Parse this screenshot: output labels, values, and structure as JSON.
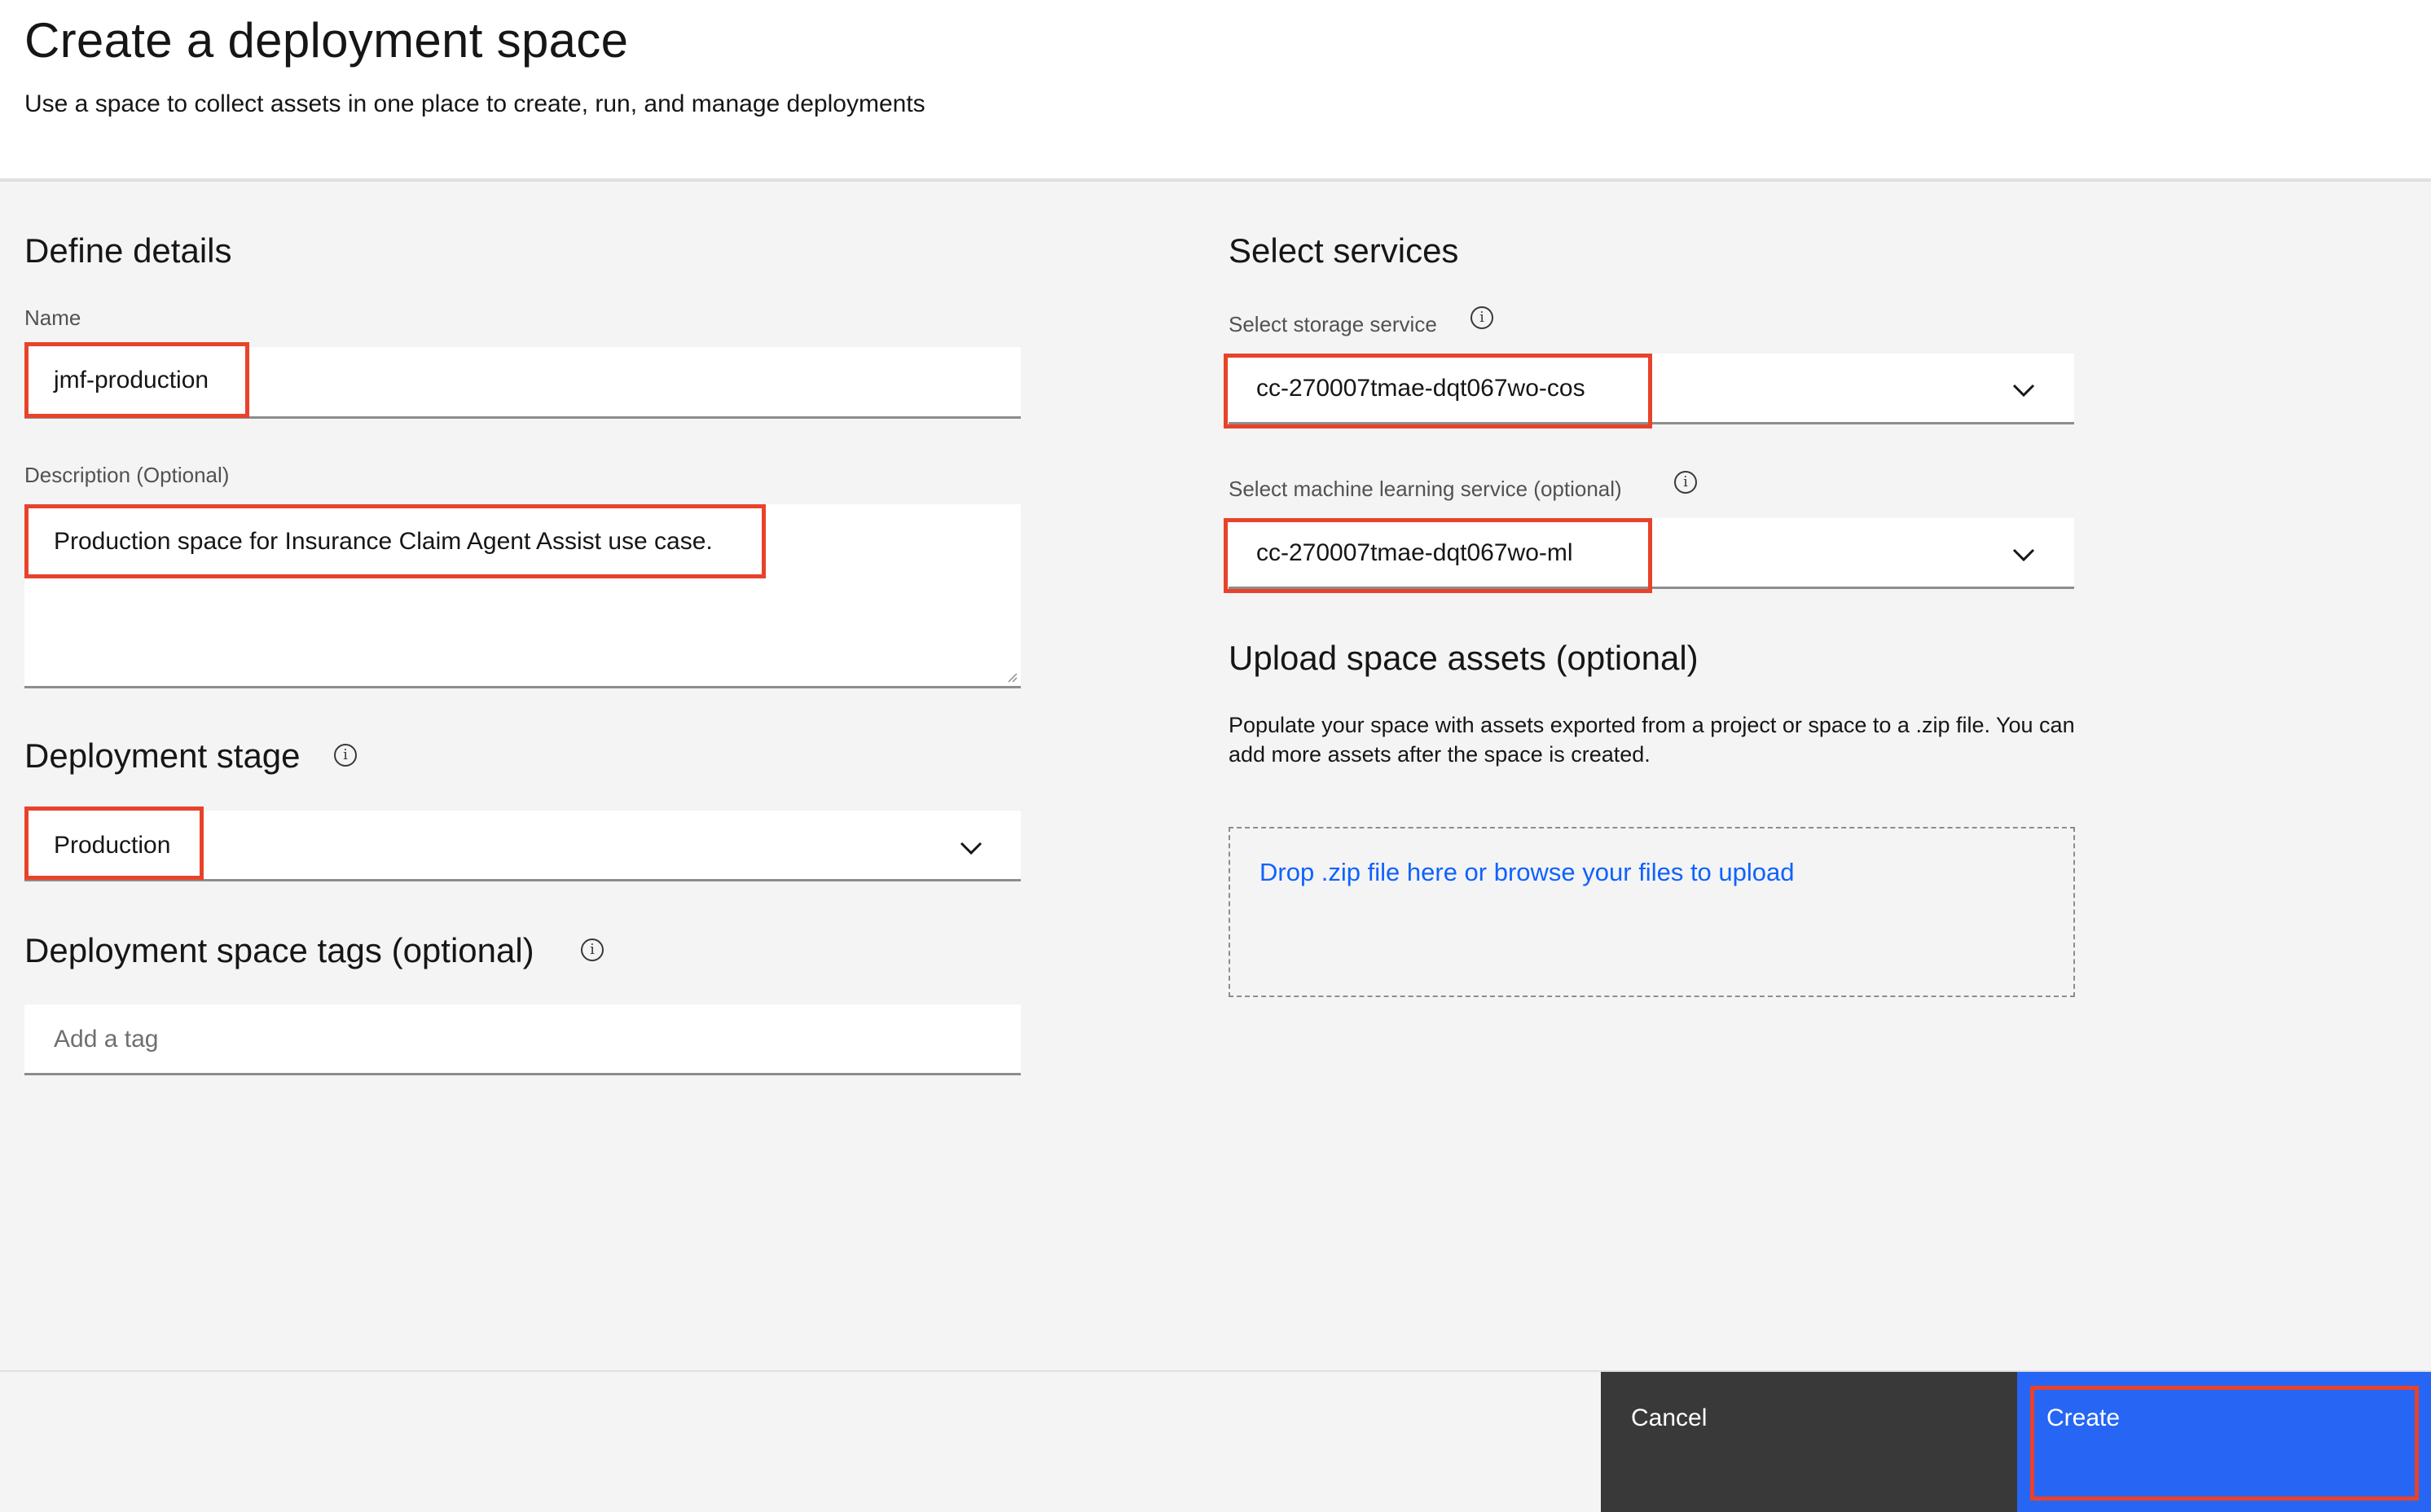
{
  "header": {
    "title": "Create a deployment space",
    "subtitle": "Use a space to collect assets in one place to create, run, and manage deployments"
  },
  "define_details": {
    "heading": "Define details",
    "name": {
      "label": "Name",
      "value": "jmf-production"
    },
    "description": {
      "label": "Description (Optional)",
      "value": "Production space for Insurance Claim Agent Assist use case."
    }
  },
  "deployment_stage": {
    "heading": "Deployment stage",
    "info_icon": "info-icon",
    "selected": "Production"
  },
  "tags": {
    "heading": "Deployment space tags (optional)",
    "info_icon": "info-icon",
    "placeholder": "Add a tag"
  },
  "services": {
    "heading": "Select services",
    "storage": {
      "label": "Select storage service",
      "selected": "cc-270007tmae-dqt067wo-cos"
    },
    "ml": {
      "label": "Select machine learning service (optional)",
      "selected": "cc-270007tmae-dqt067wo-ml"
    }
  },
  "upload": {
    "heading": "Upload space assets (optional)",
    "description": "Populate your space with assets exported from a project or space to a .zip file. You can add more assets after the space is created.",
    "dropzone_text": "Drop .zip file here or browse your files to upload"
  },
  "footer": {
    "cancel_label": "Cancel",
    "create_label": "Create"
  },
  "colors": {
    "primary": "#2766f4",
    "secondary": "#393939",
    "highlight": "#e8432a",
    "link": "#0f62fe",
    "background": "#f4f4f4"
  }
}
